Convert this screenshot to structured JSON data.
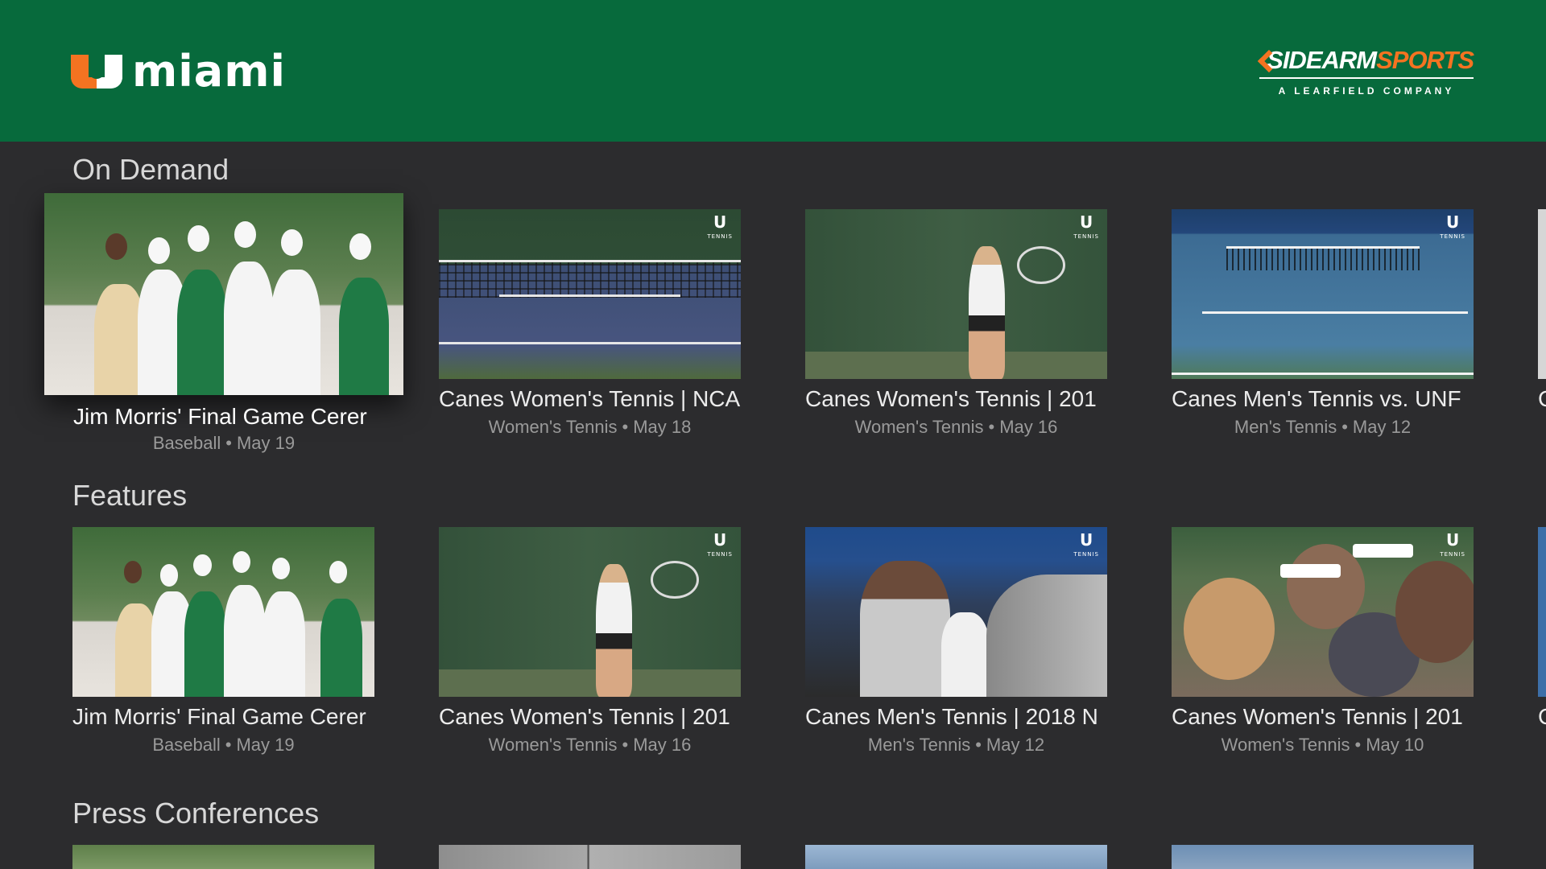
{
  "header": {
    "brand_word": "miami",
    "partner_name_white": "SIDEARM",
    "partner_name_orange": "SPORTS",
    "partner_tagline": "A LEARFIELD COMPANY",
    "bg_color": "#076a3c",
    "accent_color": "#f47321"
  },
  "sections": {
    "on_demand": {
      "title": "On Demand",
      "items": [
        {
          "title": "Jim Morris' Final Game Cerer",
          "sport": "Baseball",
          "date": "May 19",
          "focused": true,
          "icon": "baseball-thumbnail"
        },
        {
          "title": "Canes Women's Tennis | NCA",
          "sport": "Women's Tennis",
          "date": "May 18",
          "icon": "tennis-court-thumbnail"
        },
        {
          "title": "Canes Women's Tennis | 201",
          "sport": "Women's Tennis",
          "date": "May 16",
          "icon": "tennis-player-thumbnail"
        },
        {
          "title": "Canes Men's Tennis vs. UNF",
          "sport": "Men's Tennis",
          "date": "May 12",
          "icon": "tennis-court-thumbnail"
        }
      ],
      "peek_title": "C"
    },
    "features": {
      "title": "Features",
      "items": [
        {
          "title": "Jim Morris' Final Game Cerer",
          "sport": "Baseball",
          "date": "May 19",
          "icon": "baseball-thumbnail"
        },
        {
          "title": "Canes Women's Tennis | 201",
          "sport": "Women's Tennis",
          "date": "May 16",
          "icon": "tennis-player-thumbnail"
        },
        {
          "title": "Canes Men's Tennis | 2018 N",
          "sport": "Men's Tennis",
          "date": "May 12",
          "icon": "team-huddle-thumbnail"
        },
        {
          "title": "Canes Women's Tennis | 201",
          "sport": "Women's Tennis",
          "date": "May 10",
          "icon": "team-huddle-thumbnail"
        }
      ],
      "peek_title": "C"
    },
    "press_conferences": {
      "title": "Press Conferences"
    }
  },
  "thumbnail_watermark": {
    "letter": "U",
    "sub": "TENNIS"
  },
  "separator": "•"
}
